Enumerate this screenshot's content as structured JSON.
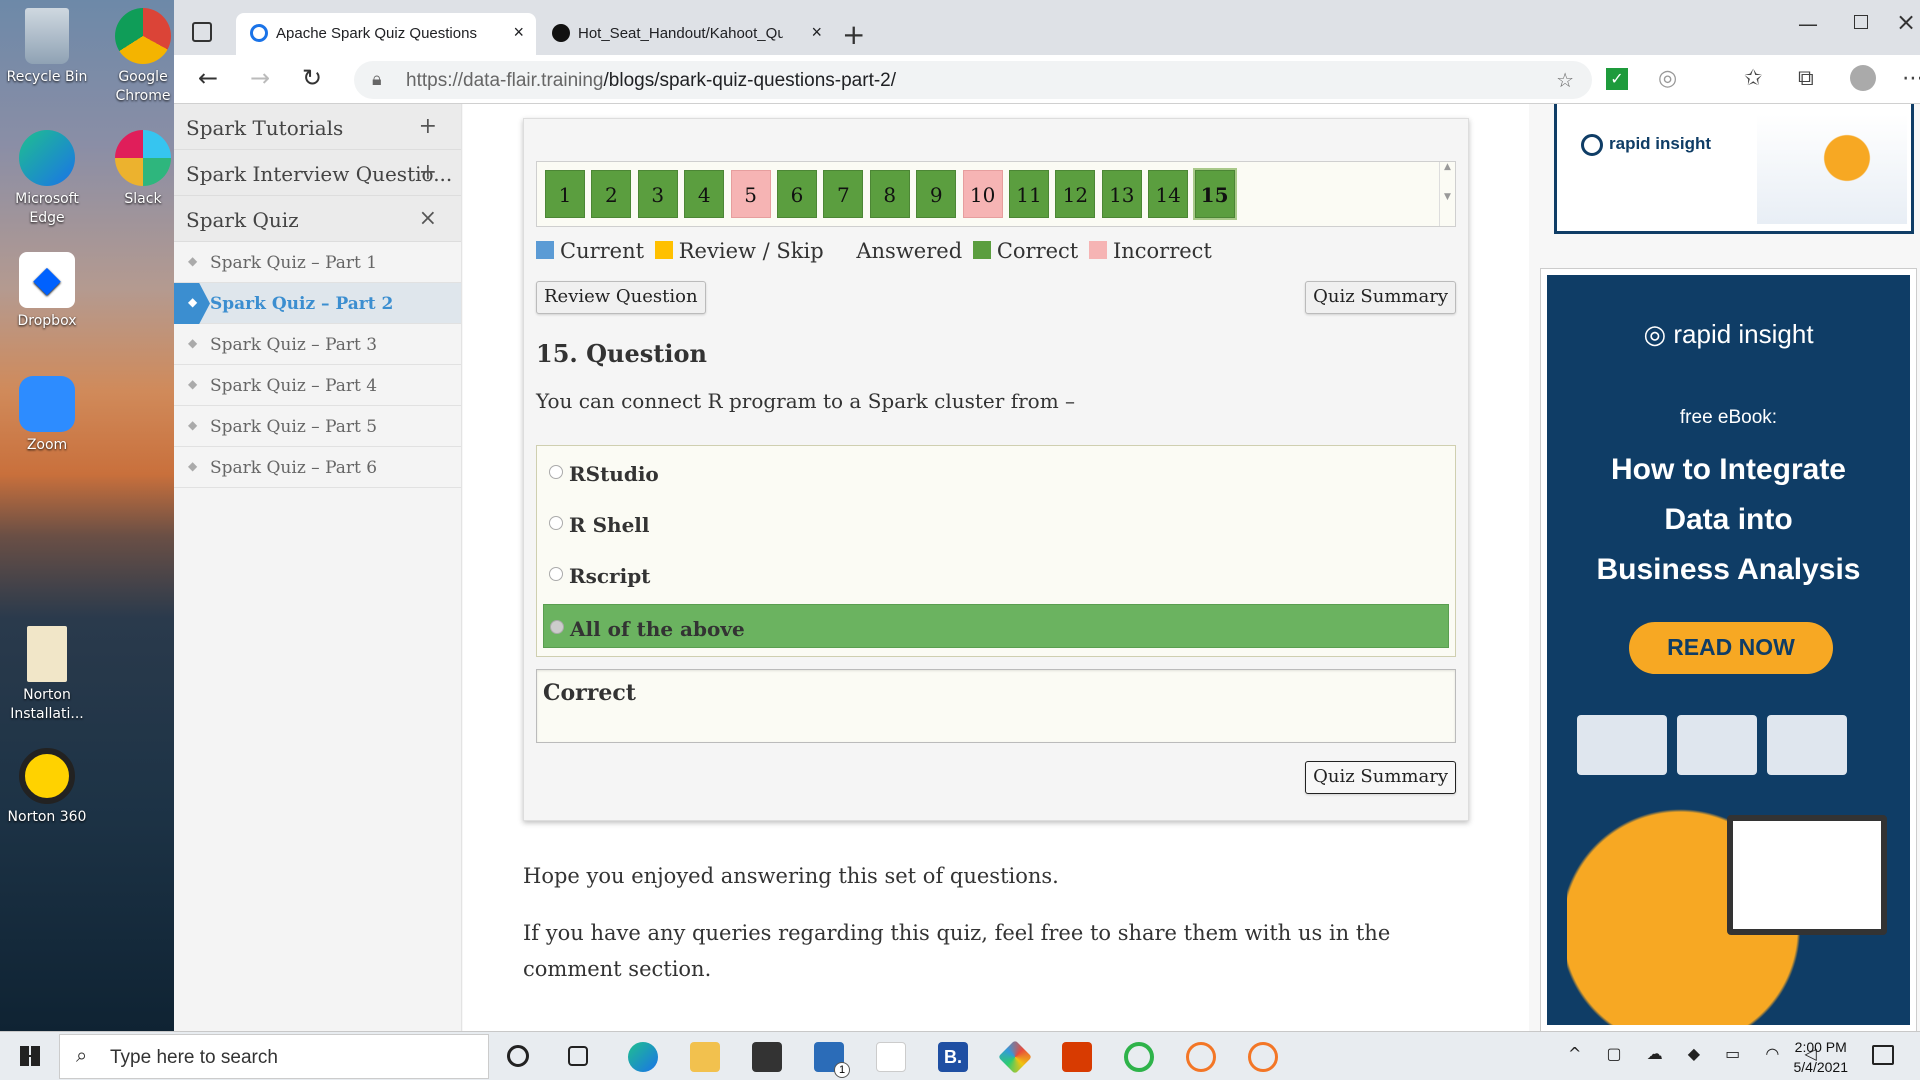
{
  "desktop": {
    "icons": [
      "Recycle Bin",
      "Google Chrome",
      "Microsoft Edge",
      "Slack",
      "Dropbox",
      "Zoom",
      "Norton Installati...",
      "Norton 360"
    ]
  },
  "browser": {
    "tabs": [
      {
        "title": "Apache Spark Quiz Questions - H",
        "active": true
      },
      {
        "title": "Hot_Seat_Handout/Kahoot_Ques",
        "active": false
      }
    ],
    "url_host": "https://data-flair.training",
    "url_path": "/blogs/spark-quiz-questions-part-2/"
  },
  "sidebar": {
    "sections": [
      {
        "label": "Spark Tutorials",
        "toggle": "+"
      },
      {
        "label": "Spark Interview Questio...",
        "toggle": "+"
      },
      {
        "label": "Spark Quiz",
        "toggle": "×"
      }
    ],
    "items": [
      {
        "label": "Spark Quiz – Part 1",
        "active": false
      },
      {
        "label": "Spark Quiz – Part 2",
        "active": true
      },
      {
        "label": "Spark Quiz – Part 3",
        "active": false
      },
      {
        "label": "Spark Quiz – Part 4",
        "active": false
      },
      {
        "label": "Spark Quiz – Part 5",
        "active": false
      },
      {
        "label": "Spark Quiz – Part 6",
        "active": false
      }
    ]
  },
  "quiz": {
    "numbers": [
      {
        "n": "1",
        "state": "correct"
      },
      {
        "n": "2",
        "state": "correct"
      },
      {
        "n": "3",
        "state": "correct"
      },
      {
        "n": "4",
        "state": "correct"
      },
      {
        "n": "5",
        "state": "incorrect"
      },
      {
        "n": "6",
        "state": "correct"
      },
      {
        "n": "7",
        "state": "correct"
      },
      {
        "n": "8",
        "state": "correct"
      },
      {
        "n": "9",
        "state": "correct"
      },
      {
        "n": "10",
        "state": "incorrect"
      },
      {
        "n": "11",
        "state": "correct"
      },
      {
        "n": "12",
        "state": "correct"
      },
      {
        "n": "13",
        "state": "correct"
      },
      {
        "n": "14",
        "state": "correct"
      },
      {
        "n": "15",
        "state": "current"
      }
    ],
    "legend": {
      "current": "Current",
      "review": "Review / Skip",
      "answered": "Answered",
      "correct": "Correct",
      "incorrect": "Incorrect"
    },
    "review_button": "Review Question",
    "summary_button": "Quiz Summary",
    "question_heading": "15. Question",
    "question_text": "You can connect R program to a Spark cluster from –",
    "answers": [
      "RStudio",
      "R Shell",
      "Rscript",
      "All of the above"
    ],
    "correct_answer_index": 3,
    "result": "Correct",
    "colors": {
      "current": "#5b9bd5",
      "review": "#ffc000",
      "correct": "#5b9e3f",
      "incorrect": "#f6b4b4"
    }
  },
  "article": {
    "p1": "Hope you enjoyed answering this set of questions.",
    "p2": "If you have any queries regarding this quiz, feel free to share them with us in the comment section."
  },
  "ads": {
    "brand": "rapid insight",
    "subtitle": "free eBook:",
    "headline_lines": [
      "How to Integrate",
      "Data into",
      "Business Analysis"
    ],
    "cta": "READ NOW"
  },
  "taskbar": {
    "search_placeholder": "Type here to search",
    "time": "2:00 PM",
    "date": "5/4/2021",
    "mail_badge": "1"
  }
}
